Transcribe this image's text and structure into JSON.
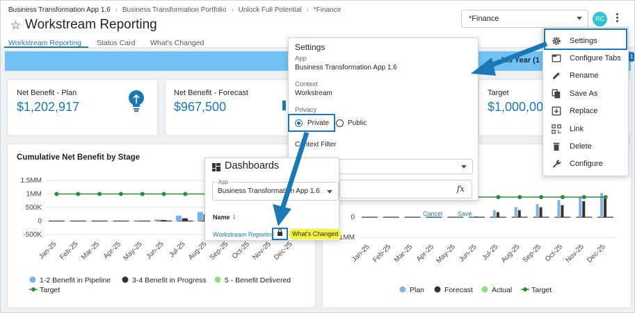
{
  "breadcrumb": [
    "Business Transformation App 1.6",
    "Business Transformation Portfolio",
    "Unlock Full Potential",
    "*Finance"
  ],
  "page_title": "Workstream Reporting",
  "tabs": [
    {
      "label": "Workstream Reporting",
      "active": true
    },
    {
      "label": "Status Card",
      "active": false
    },
    {
      "label": "What's Changed",
      "active": false
    }
  ],
  "context_select": "*Finance",
  "avatar_initials": "RC",
  "band": {
    "text": "his Year (1",
    "badge": "1"
  },
  "cards": [
    {
      "label": "Net Benefit - Plan",
      "value": "$1,202,917"
    },
    {
      "label": "Net Benefit - Forecast",
      "value": "$967,500"
    },
    {
      "label": "Target",
      "value": "$1,000,00"
    }
  ],
  "chart_titles": {
    "left": "Cumulative Net Benefit by Stage"
  },
  "settings_panel": {
    "title": "Settings",
    "app_label": "App",
    "app_value": "Business Transformation App 1.6",
    "context_label": "Context",
    "context_value": "Workstream",
    "privacy_label": "Privacy",
    "private_label": "Private",
    "public_label": "Public",
    "context_filter_label": "Context Filter"
  },
  "dashboards_panel": {
    "title": "Dashboards",
    "app_label": "App",
    "app_value": "Business Transformation App 1.6",
    "name_header": "Name",
    "row_name": "Workstream Reporting",
    "row_badge": "What's Changed",
    "cancel_label": "Cancel",
    "save_label": "Save",
    "fx_label": "fx"
  },
  "menu": {
    "items": [
      {
        "label": "Settings",
        "icon": "gear-icon"
      },
      {
        "label": "Configure Tabs",
        "icon": "tabs-icon"
      },
      {
        "label": "Rename",
        "icon": "pencil-icon"
      },
      {
        "label": "Save As",
        "icon": "copy-icon"
      },
      {
        "label": "Replace",
        "icon": "replace-icon"
      },
      {
        "label": "Link",
        "icon": "qr-code-icon"
      },
      {
        "label": "Delete",
        "icon": "trash-icon"
      },
      {
        "label": "Configure",
        "icon": "wrench-icon"
      }
    ]
  },
  "colors": {
    "accent": "#1a78b4",
    "band": "#73c2f5",
    "plan": "#7fb3e3",
    "forecast": "#333333",
    "actual": "#8ee07a",
    "target": "#2e8b3a"
  },
  "chart_data": [
    {
      "type": "bar",
      "title": "Cumulative Net Benefit by Stage",
      "categories": [
        "Jan-25",
        "Feb-25",
        "Mar-25",
        "Apr-25",
        "May-25",
        "Jun-25",
        "Jul-25",
        "Aug-25",
        "Sep-25",
        "Oct-25",
        "Nov-25",
        "Dec-25"
      ],
      "yticks": [
        "1.5MM",
        "1MM",
        "500K",
        "0",
        "-500K"
      ],
      "ylim": [
        -500000,
        1500000
      ],
      "series": [
        {
          "name": "1-2 Benefit in Pipeline",
          "kind": "bar",
          "color": "#7fb3e3",
          "values": [
            0,
            0,
            0,
            0,
            20000,
            60000,
            200000,
            330000,
            0,
            0,
            0,
            0
          ]
        },
        {
          "name": "3-4 Benefit in Progress",
          "kind": "bar",
          "color": "#333333",
          "values": [
            0,
            0,
            0,
            0,
            0,
            40000,
            100000,
            250000,
            0,
            0,
            0,
            0
          ]
        },
        {
          "name": "5 - Benefit Delivered",
          "kind": "bar",
          "color": "#8ee07a",
          "values": [
            0,
            0,
            0,
            0,
            0,
            0,
            0,
            0,
            0,
            0,
            0,
            0
          ]
        },
        {
          "name": "Target",
          "kind": "line",
          "color": "#2e8b3a",
          "values": [
            1000000,
            1000000,
            1000000,
            1000000,
            1000000,
            1000000,
            1000000,
            1000000,
            1000000,
            1000000,
            1000000,
            1000000
          ]
        }
      ],
      "legend": "bottom"
    },
    {
      "type": "bar",
      "title": "",
      "categories": [
        "Jan-25",
        "Feb-25",
        "Mar-25",
        "Apr-25",
        "May-25",
        "Jun-25",
        "Jul-25",
        "Aug-25",
        "Sep-25",
        "Oct-25",
        "Nov-25",
        "Dec-25"
      ],
      "yticks": [
        "0",
        "-1MM"
      ],
      "ylim": [
        -1000000,
        1000000
      ],
      "series": [
        {
          "name": "Plan",
          "kind": "bar",
          "color": "#7fb3e3",
          "values": [
            0,
            0,
            0,
            0,
            0,
            50000,
            350000,
            500000,
            650000,
            850000,
            1000000,
            1200000
          ]
        },
        {
          "name": "Forecast",
          "kind": "bar",
          "color": "#333333",
          "values": [
            0,
            0,
            0,
            0,
            0,
            30000,
            250000,
            350000,
            500000,
            600000,
            800000,
            950000
          ]
        },
        {
          "name": "Actual",
          "kind": "bar",
          "color": "#8ee07a",
          "values": [
            0,
            0,
            0,
            0,
            0,
            0,
            0,
            0,
            0,
            0,
            0,
            0
          ]
        },
        {
          "name": "Target",
          "kind": "line",
          "color": "#2e8b3a",
          "values": [
            1000000,
            1000000,
            1000000,
            1000000,
            1000000,
            1000000,
            1000000,
            1000000,
            1000000,
            1000000,
            1000000,
            1000000
          ]
        }
      ],
      "legend": "bottom"
    }
  ]
}
